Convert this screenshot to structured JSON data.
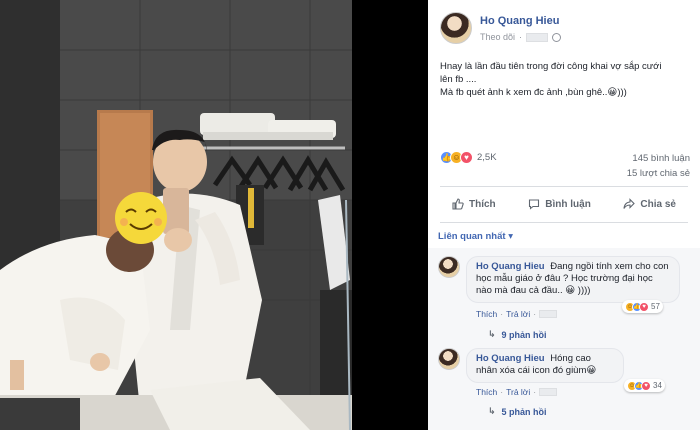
{
  "post": {
    "author": "Ho Quang Hieu",
    "follow_label": "Theo dõi",
    "text_lines": [
      "Hnay là lần đầu tiên trong đời công khai vợ sắp cưới",
      "lên fb ....",
      "Mà fb quét ảnh k xem đc ảnh ,bùn ghê..😀)))"
    ],
    "reaction_count": "2,5K",
    "comments_count": "145 bình luận",
    "shares_count": "15 lượt chia sẻ",
    "actions": {
      "like": "Thích",
      "comment": "Bình luận",
      "share": "Chia sẻ"
    },
    "filter_label": "Liên quan nhất ▾"
  },
  "comments": [
    {
      "author": "Ho Quang Hieu",
      "text": "Đang ngồi tính xem cho con học mẫu giáo ở đâu ? Học trường đại học nào mà đau cả đầu.. 😀 ))))",
      "like_label": "Thích",
      "reply_label": "Trả lời",
      "reaction_count": "57",
      "replies_label": "9 phản hồi"
    },
    {
      "author": "Ho Quang Hieu",
      "text": "Hóng cao nhân xóa cái icon đó giùm😀",
      "like_label": "Thích",
      "reply_label": "Trả lời",
      "reaction_count": "34",
      "replies_label": "5 phản hồi"
    }
  ],
  "colors": {
    "link_blue": "#385898",
    "panel_bg": "#ffffff",
    "emoji_yellow": "#f5d83a"
  }
}
